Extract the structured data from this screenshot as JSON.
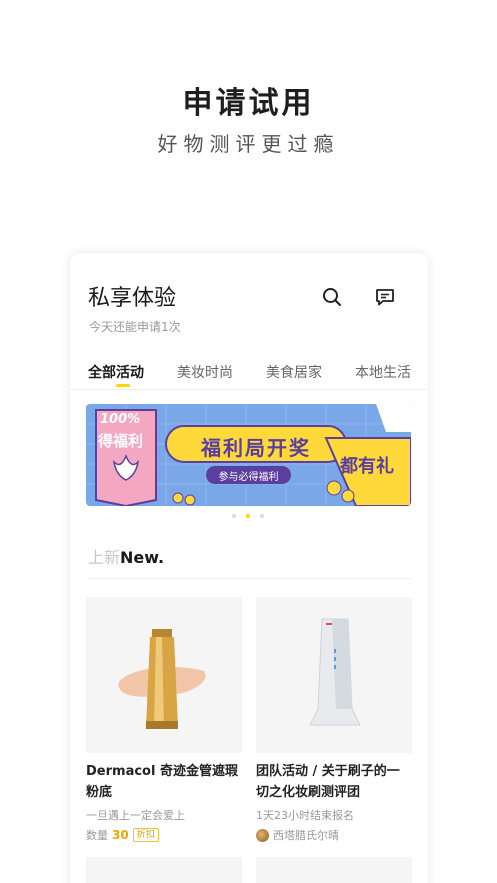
{
  "hero": {
    "title": "申请试用",
    "subtitle": "好物测评更过瘾"
  },
  "header": {
    "title": "私享体验",
    "subtitle": "今天还能申请1次",
    "search_icon": "search-icon",
    "message_icon": "message-icon"
  },
  "tabs": [
    {
      "label": "全部活动",
      "active": true
    },
    {
      "label": "美妆时尚",
      "active": false
    },
    {
      "label": "美食居家",
      "active": false
    },
    {
      "label": "本地生活",
      "active": false
    }
  ],
  "banner": {
    "badge_text": "100%",
    "left_text": "得福利",
    "title": "福利局开奖",
    "subtitle": "参与必得福利",
    "right_text": "都有礼",
    "colors": {
      "bg": "#7aa7e8",
      "pink": "#f4a7c0",
      "yellow": "#ffd83a",
      "purple": "#5b3fa0"
    }
  },
  "carousel": {
    "count": 3,
    "active_index": 1
  },
  "section": {
    "title_gray": "上新",
    "title_dark": "New."
  },
  "products": [
    {
      "name": "Dermacol 奇迹金管遮瑕粉底",
      "desc": "一旦遇上一定会爱上",
      "qty_label": "数量",
      "qty_value": "30",
      "badge": "折扣"
    },
    {
      "name": "团队活动 / 关于刷子的一切之化妆刷测评团",
      "desc": "1天23小时结束报名",
      "author": "西塔腊氏尔晴"
    }
  ],
  "colors": {
    "accent": "#ffd400",
    "text": "#222222",
    "muted": "#999999"
  }
}
